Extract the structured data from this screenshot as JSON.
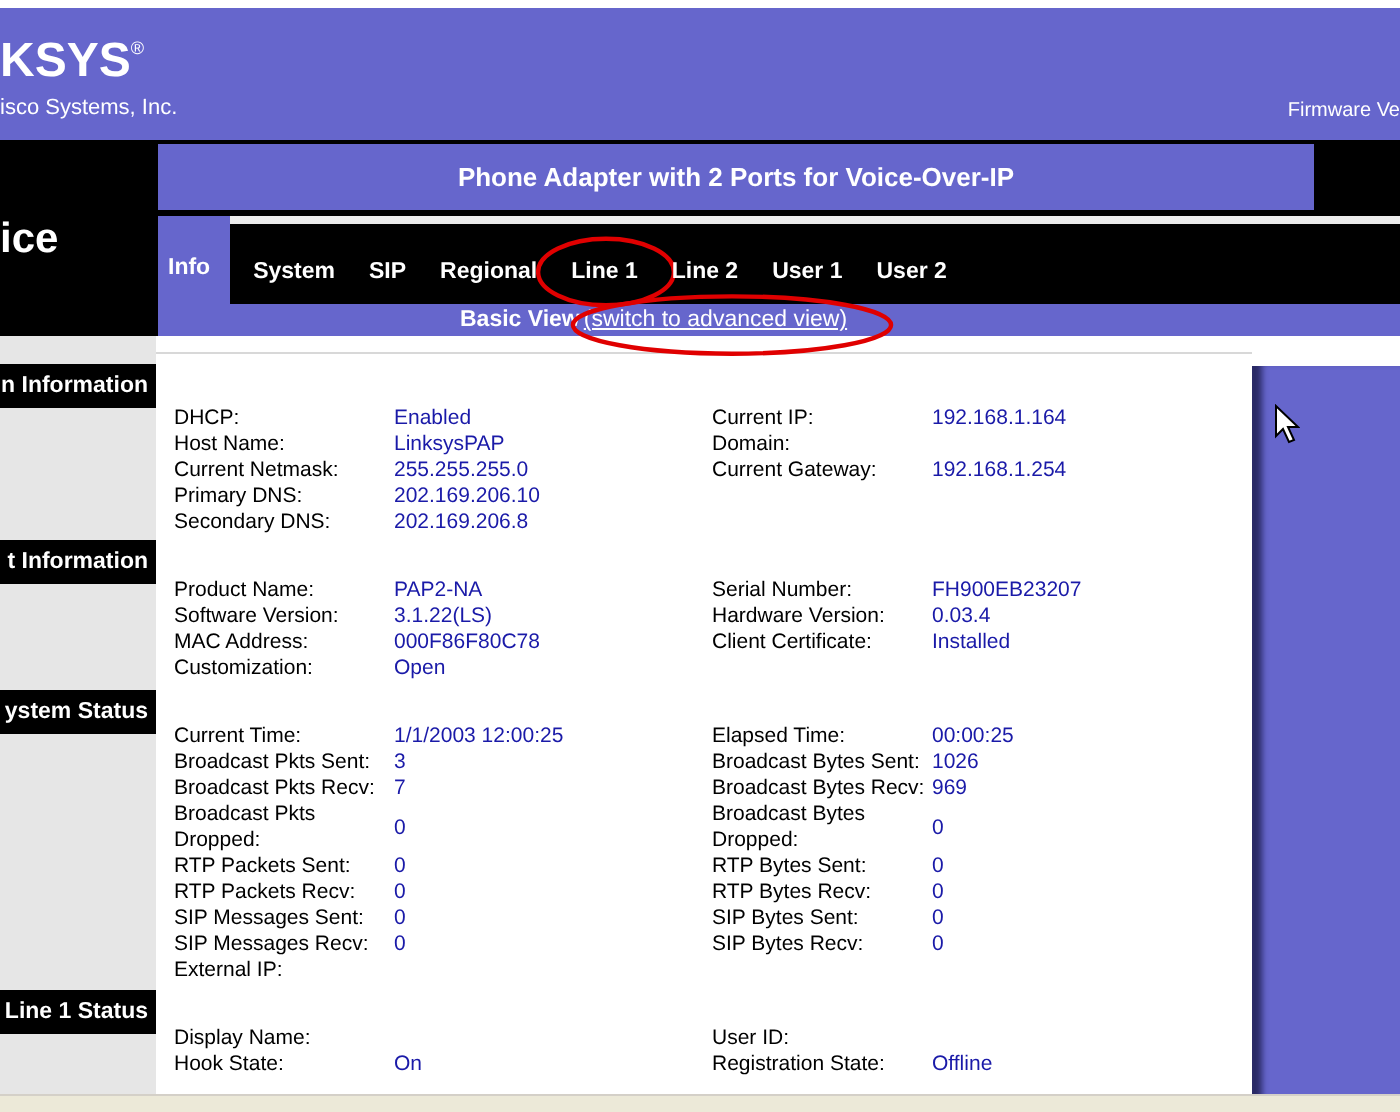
{
  "header": {
    "logo": "KSYS$^{®}$",
    "company": "isco Systems, Inc.",
    "firmware": "Firmware Ve"
  },
  "product_label": "ice",
  "title": "Phone Adapter with 2 Ports for Voice-Over-IP",
  "tabs": [
    {
      "label": "Info",
      "selected": true,
      "circled": false
    },
    {
      "label": "System",
      "selected": false,
      "circled": false
    },
    {
      "label": "SIP",
      "selected": false,
      "circled": false
    },
    {
      "label": "Regional",
      "selected": false,
      "circled": false
    },
    {
      "label": "Line 1",
      "selected": false,
      "circled": true
    },
    {
      "label": "Line 2",
      "selected": false,
      "circled": false
    },
    {
      "label": "User 1",
      "selected": false,
      "circled": false
    },
    {
      "label": "User 2",
      "selected": false,
      "circled": false
    }
  ],
  "view": {
    "label": "Basic View",
    "link": "(switch to advanced view)",
    "circled": true
  },
  "sections": [
    {
      "heading": "n Information",
      "left": [
        {
          "label": "DHCP:",
          "value": "Enabled"
        },
        {
          "label": "Host Name:",
          "value": "LinksysPAP"
        },
        {
          "label": "Current Netmask:",
          "value": "255.255.255.0"
        },
        {
          "label": "Primary DNS:",
          "value": "202.169.206.10"
        },
        {
          "label": "Secondary DNS:",
          "value": "202.169.206.8"
        }
      ],
      "right": [
        {
          "label": "Current IP:",
          "value": "192.168.1.164"
        },
        {
          "label": "Domain:"
        },
        {
          "label": "Current Gateway:",
          "value": "192.168.1.254"
        }
      ]
    },
    {
      "heading": "t Information",
      "left": [
        {
          "label": "Product Name:",
          "value": "PAP2-NA"
        },
        {
          "label": "Software Version:",
          "value": "3.1.22(LS)"
        },
        {
          "label": "MAC Address:",
          "value": "000F86F80C78"
        },
        {
          "label": "Customization:",
          "value": "Open"
        }
      ],
      "right": [
        {
          "label": "Serial Number:",
          "value": "FH900EB23207"
        },
        {
          "label": "Hardware Version:",
          "value": "0.03.4"
        },
        {
          "label": "Client Certificate:",
          "value": "Installed"
        }
      ]
    },
    {
      "heading": "ystem Status",
      "left": [
        {
          "label": "Current Time:",
          "value": "1/1/2003 12:00:25"
        },
        {
          "label": "Broadcast Pkts Sent:",
          "value": "3"
        },
        {
          "label": "Broadcast Pkts Recv:",
          "value": "7"
        },
        {
          "label": "Broadcast Pkts Dropped:",
          "value": "0"
        },
        {
          "label": "RTP Packets Sent:",
          "value": "0"
        },
        {
          "label": "RTP Packets Recv:",
          "value": "0"
        },
        {
          "label": "SIP Messages Sent:",
          "value": "0"
        },
        {
          "label": "SIP Messages Recv:",
          "value": "0"
        },
        {
          "label": "External IP:"
        }
      ],
      "right": [
        {
          "label": "Elapsed Time:",
          "value": "00:00:25"
        },
        {
          "label": "Broadcast Bytes Sent:",
          "value": "1026"
        },
        {
          "label": "Broadcast Bytes Recv:",
          "value": "969"
        },
        {
          "label": "Broadcast Bytes Dropped:",
          "value": "0"
        },
        {
          "label": "RTP Bytes Sent:",
          "value": "0"
        },
        {
          "label": "RTP Bytes Recv:",
          "value": "0"
        },
        {
          "label": "SIP Bytes Sent:",
          "value": "0"
        },
        {
          "label": "SIP Bytes Recv:",
          "value": "0"
        }
      ]
    },
    {
      "heading": "Line 1 Status",
      "left": [
        {
          "label": "Display Name:"
        },
        {
          "label": "Hook State:",
          "value": "On"
        }
      ],
      "right": [
        {
          "label": "User ID:"
        },
        {
          "label": "Registration State:",
          "value": "Offline"
        }
      ]
    }
  ]
}
